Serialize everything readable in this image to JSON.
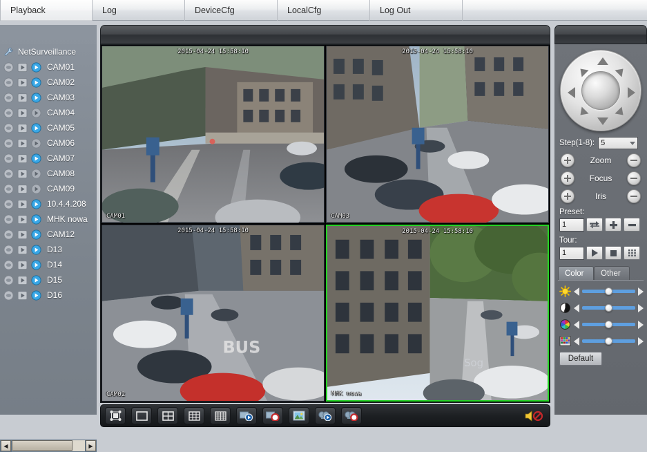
{
  "menu": {
    "items": [
      {
        "label": "Playback",
        "name": "menu-playback"
      },
      {
        "label": "Log",
        "name": "menu-log"
      },
      {
        "label": "DeviceCfg",
        "name": "menu-devicecfg"
      },
      {
        "label": "LocalCfg",
        "name": "menu-localcfg"
      },
      {
        "label": "Log Out",
        "name": "menu-logout"
      }
    ]
  },
  "sidebar": {
    "root_label": "NetSurveillance",
    "cameras": [
      {
        "label": "CAM01",
        "connected": true
      },
      {
        "label": "CAM02",
        "connected": true
      },
      {
        "label": "CAM03",
        "connected": true
      },
      {
        "label": "CAM04",
        "connected": false
      },
      {
        "label": "CAM05",
        "connected": true
      },
      {
        "label": "CAM06",
        "connected": false
      },
      {
        "label": "CAM07",
        "connected": true
      },
      {
        "label": "CAM08",
        "connected": false
      },
      {
        "label": "CAM09",
        "connected": false
      },
      {
        "label": "10.4.4.208",
        "connected": true
      },
      {
        "label": "MHK nowa",
        "connected": true
      },
      {
        "label": "CAM12",
        "connected": true
      },
      {
        "label": "D13",
        "connected": true
      },
      {
        "label": "D14",
        "connected": true
      },
      {
        "label": "D15",
        "connected": true
      },
      {
        "label": "D16",
        "connected": true
      }
    ]
  },
  "video": {
    "cells": [
      {
        "name": "CAM01",
        "time": "2015-04-24 15:58:10",
        "selected": false
      },
      {
        "name": "CAM03",
        "time": "2015-04-24 15:58:10",
        "selected": false
      },
      {
        "name": "CAM02",
        "time": "2015-04-24 15:58:10",
        "selected": false
      },
      {
        "name": "MHK nowa",
        "time": "2015-04-24 15:58:10",
        "selected": true
      }
    ]
  },
  "toolbar": {
    "buttons": [
      {
        "name": "fullscreen-button",
        "icon": "fullscreen-icon"
      },
      {
        "name": "layout-1-button",
        "icon": "layout-1-icon"
      },
      {
        "name": "layout-4-button",
        "icon": "layout-4-icon"
      },
      {
        "name": "layout-9-button",
        "icon": "layout-9-icon"
      },
      {
        "name": "layout-16-button",
        "icon": "layout-16-icon"
      },
      {
        "name": "start-all-preview-button",
        "icon": "play-all-icon"
      },
      {
        "name": "stop-all-preview-button",
        "icon": "stop-all-icon"
      },
      {
        "name": "snapshot-button",
        "icon": "picture-icon"
      },
      {
        "name": "start-record-button",
        "icon": "record-play-icon"
      },
      {
        "name": "stop-record-button",
        "icon": "record-stop-icon"
      }
    ],
    "audio_label": "audio-muted-icon"
  },
  "ptz": {
    "step_label": "Step(1-8):",
    "step_value": "5",
    "controls": [
      {
        "label": "Zoom",
        "name": "zoom"
      },
      {
        "label": "Focus",
        "name": "focus"
      },
      {
        "label": "Iris",
        "name": "iris"
      }
    ],
    "preset_label": "Preset:",
    "preset_value": "1",
    "preset_buttons": [
      {
        "name": "preset-goto-button",
        "icon": "swap-arrows-icon"
      },
      {
        "name": "preset-add-button",
        "icon": "plus-icon"
      },
      {
        "name": "preset-remove-button",
        "icon": "minus-icon"
      }
    ],
    "tour_label": "Tour:",
    "tour_value": "1",
    "tour_buttons": [
      {
        "name": "tour-start-button",
        "icon": "play-icon"
      },
      {
        "name": "tour-stop-button",
        "icon": "stop-icon"
      },
      {
        "name": "tour-list-button",
        "icon": "grid-icon"
      }
    ]
  },
  "color": {
    "tabs": [
      {
        "label": "Color",
        "active": true
      },
      {
        "label": "Other",
        "active": false
      }
    ],
    "sliders": [
      {
        "name": "brightness",
        "icon": "brightness-sun-icon",
        "value": 50
      },
      {
        "name": "contrast",
        "icon": "contrast-icon",
        "value": 50
      },
      {
        "name": "hue",
        "icon": "hue-wheel-icon",
        "value": 50
      },
      {
        "name": "saturation",
        "icon": "saturation-grid-icon",
        "value": 50
      }
    ],
    "default_label": "Default"
  },
  "colors": {
    "accent_green": "#25d425",
    "slider_blue": "#5e9fe0",
    "panel_gray": "#6f7379",
    "sidebar_gray": "#8a929c"
  }
}
